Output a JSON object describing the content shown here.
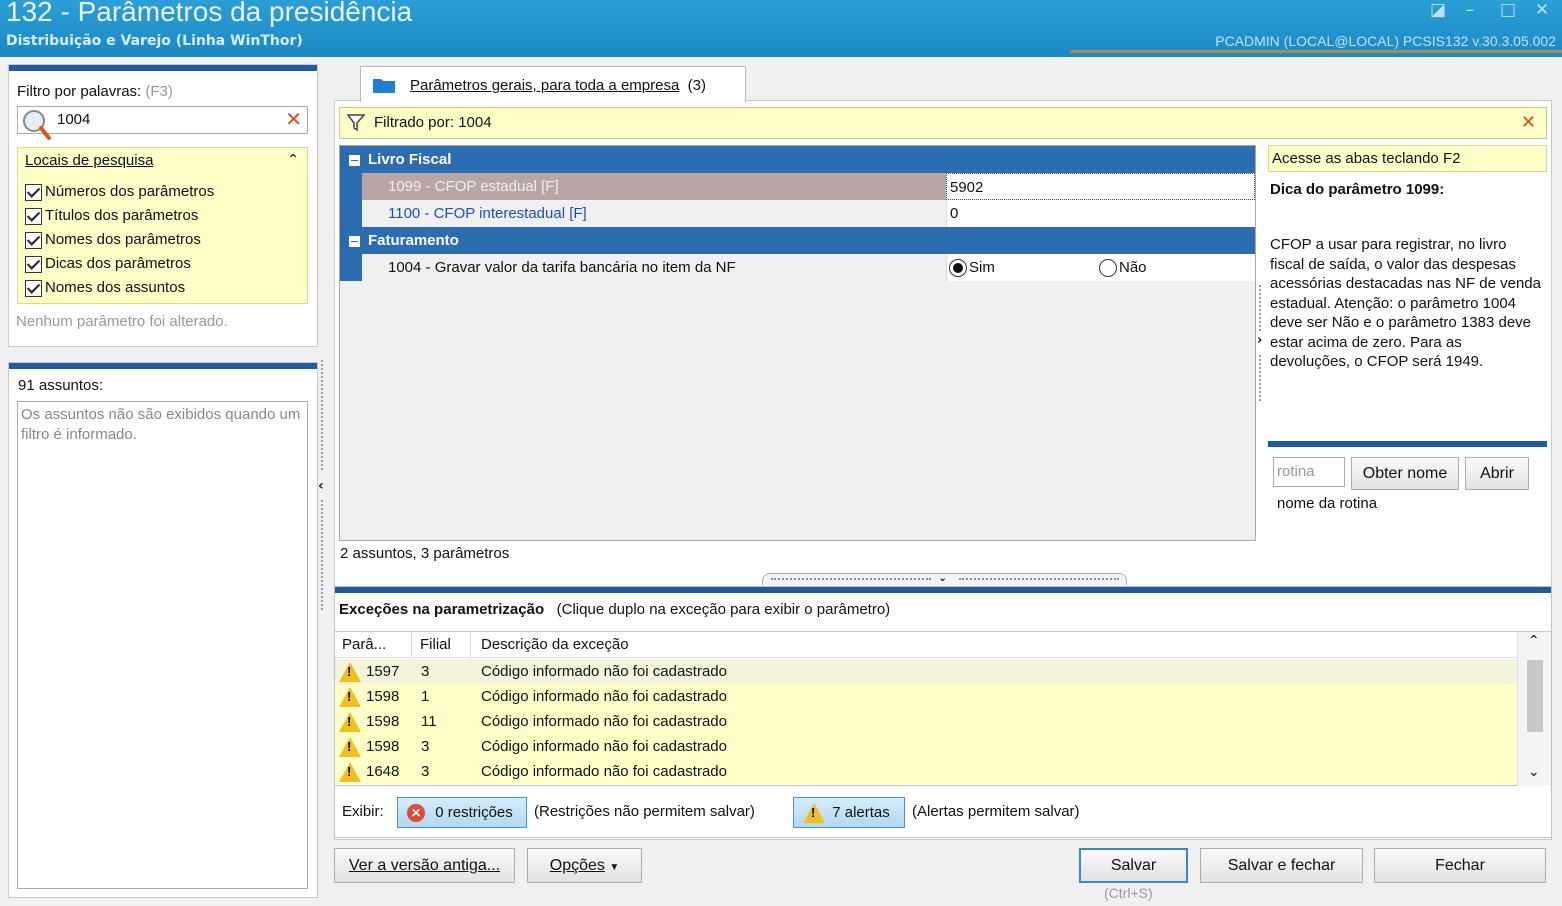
{
  "window": {
    "title": "132 - Parâmetros da presidência",
    "subtitle": "Distribuição e Varejo (Linha WinThor)",
    "user_info": "PCADMIN (LOCAL@LOCAL)   PCSIS132  v.30.3.05.002"
  },
  "filter": {
    "label": "Filtro por palavras:",
    "shortcut": "(F3)",
    "value": "1004",
    "search_locations_title": "Locais de pesquisa",
    "options": [
      {
        "label": "Números dos parâmetros",
        "checked": true
      },
      {
        "label": "Títulos dos parâmetros",
        "checked": true
      },
      {
        "label": "Nomes dos parâmetros",
        "checked": true
      },
      {
        "label": "Dicas dos parâmetros",
        "checked": true
      },
      {
        "label": "Nomes dos assuntos",
        "checked": true
      }
    ],
    "status": "Nenhum parâmetro foi alterado."
  },
  "subjects": {
    "count_label": "91 assuntos:",
    "message": "Os assuntos não são exibidos quando um filtro é informado."
  },
  "tab": {
    "label": "Parâmetros gerais, para toda a empresa",
    "count": "(3)"
  },
  "filter_bar": {
    "text": "Filtrado por: 1004"
  },
  "grid": {
    "groups": [
      {
        "title": "Livro Fiscal"
      },
      {
        "title": "Faturamento"
      }
    ],
    "rows": [
      {
        "name": "1099 - CFOP estadual [F]",
        "value": "5902"
      },
      {
        "name": "1100 - CFOP interestadual [F]",
        "value": "0"
      },
      {
        "name": "1004 - Gravar valor da tarifa bancária no item da NF",
        "opt_yes": "Sim",
        "opt_no": "Não",
        "selected": "Sim"
      }
    ],
    "summary": "2 assuntos, 3 parâmetros"
  },
  "hint": {
    "tabs_tip": "Acesse as abas teclando F2",
    "title": "Dica do parâmetro 1099:",
    "body": "CFOP a usar para registrar, no livro fiscal de saída, o valor das despesas acessórias destacadas nas NF de venda estadual. Atenção: o parâmetro 1004 deve ser Não e o parâmetro 1383 deve estar acima de zero. Para as devoluções, o CFOP será 1949.",
    "rotina_placeholder": "rotina",
    "get_name_button": "Obter nome",
    "open_button": "Abrir",
    "rotina_name_label": "nome da rotina"
  },
  "exceptions": {
    "title": "Exceções na parametrização",
    "subtitle": "(Clique duplo na exceção para exibir o parâmetro)",
    "columns": [
      "Parâ...",
      "Filial",
      "Descrição da exceção"
    ],
    "rows": [
      {
        "param": "1597",
        "filial": "3",
        "desc": "Código informado não foi cadastrado"
      },
      {
        "param": "1598",
        "filial": "1",
        "desc": "Código informado não foi cadastrado"
      },
      {
        "param": "1598",
        "filial": "11",
        "desc": "Código informado não foi cadastrado"
      },
      {
        "param": "1598",
        "filial": "3",
        "desc": "Código informado não foi cadastrado"
      },
      {
        "param": "1648",
        "filial": "3",
        "desc": "Código informado não foi cadastrado"
      }
    ],
    "show_label": "Exibir:",
    "restrictions_button": "0 restrições",
    "restrictions_note": "(Restrições não permitem salvar)",
    "alerts_button": "7 alertas",
    "alerts_note": "(Alertas permitem salvar)"
  },
  "footer": {
    "old_version_button": "Ver a versão antiga...",
    "options_button": "Opções",
    "save_button": "Salvar",
    "save_shortcut": "(Ctrl+S)",
    "save_close_button": "Salvar e fechar",
    "close_button": "Fechar"
  }
}
